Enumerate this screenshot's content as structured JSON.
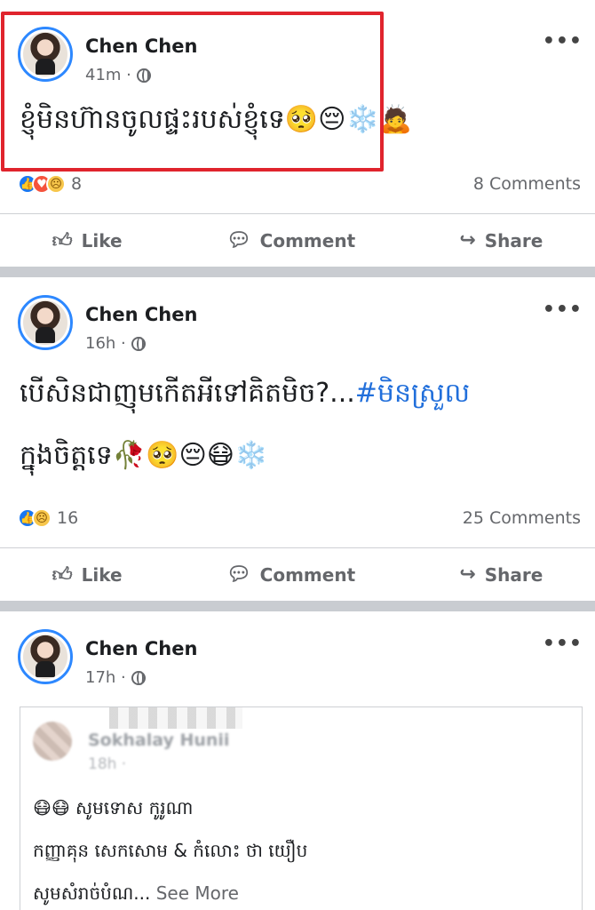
{
  "posts": [
    {
      "author": "Chen Chen",
      "time": "41m ·",
      "text": "ខ្ញុំមិនហ៊ានចូលផ្ទះរបស់ខ្ញុំទេ🥺😔❄️🙇",
      "reaction_count": "8",
      "comments": "8 Comments"
    },
    {
      "author": "Chen Chen",
      "time": "16h ·",
      "text_line1": "បើសិនជាញុមកើតអីទៅគិតមិច?...",
      "hashtag_line1": "#មិនស្រួល",
      "text_line2": "ក្នុងចិត្តទេ🥀🥺😔😷❄️",
      "reaction_count": "16",
      "comments": "25 Comments"
    },
    {
      "author": "Chen Chen",
      "time": "17h ·",
      "shared": {
        "author": "Sokhalay Hunii",
        "time": "18h ·",
        "line1": "😷😷 សូមទោស កូរូណា",
        "line2": "កញ្ញាគុន សេកសោម & កំលោះ ថា យឿប",
        "line3": "សូមសំរាច់បំណ...",
        "see_more": "See More"
      }
    }
  ],
  "actions": {
    "like": "Like",
    "comment": "Comment",
    "share": "Share"
  },
  "more_icon": "•••",
  "colors": {
    "accent": "#1877f2",
    "hashtag": "#216fdb",
    "highlight": "#e0242d"
  }
}
